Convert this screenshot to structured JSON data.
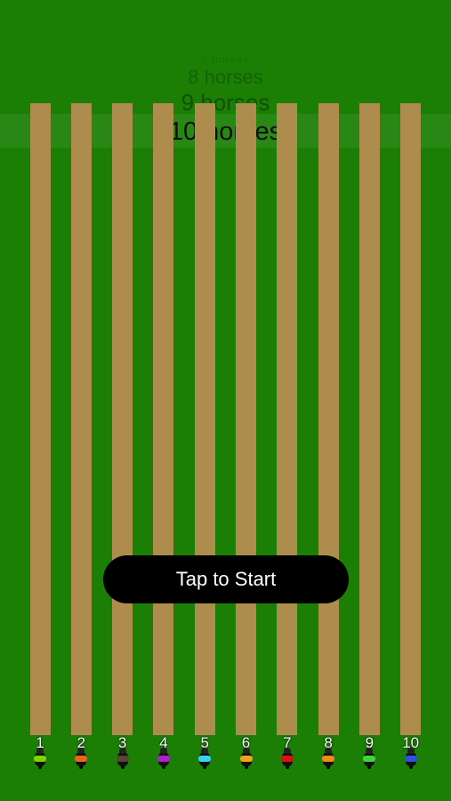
{
  "horse_count_picker": {
    "options": [
      "7 horses",
      "8 horses",
      "9 horses",
      "10 horses"
    ],
    "selected": "10 horses"
  },
  "start_button": {
    "label": "Tap to Start"
  },
  "lanes": [
    {
      "number": "1",
      "saddle_color": "#7fd400"
    },
    {
      "number": "2",
      "saddle_color": "#e8661c"
    },
    {
      "number": "3",
      "saddle_color": "#5a4630"
    },
    {
      "number": "4",
      "saddle_color": "#b020c8"
    },
    {
      "number": "5",
      "saddle_color": "#36d2f0"
    },
    {
      "number": "6",
      "saddle_color": "#f0a020"
    },
    {
      "number": "7",
      "saddle_color": "#e01010"
    },
    {
      "number": "8",
      "saddle_color": "#f08a1a"
    },
    {
      "number": "9",
      "saddle_color": "#3ed43e"
    },
    {
      "number": "10",
      "saddle_color": "#3050e0"
    }
  ]
}
